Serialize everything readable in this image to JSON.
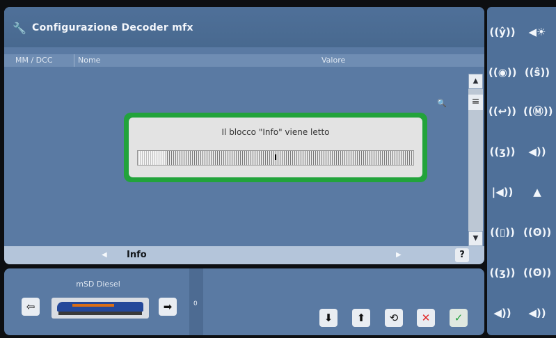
{
  "window": {
    "title": "Configurazione Decoder mfx",
    "title_icon": "wrench-icon"
  },
  "columns": {
    "mm_dcc": "MM / DCC",
    "nome": "Nome",
    "valore": "Valore"
  },
  "dialog": {
    "message": "Il blocco \"Info\" viene letto",
    "progress_mark": "I"
  },
  "nav": {
    "label": "Info",
    "left_arrow": "◀",
    "right_arrow": "▶",
    "help": "?"
  },
  "scroll": {
    "up": "▲",
    "down": "▼",
    "menu": "≡"
  },
  "loco": {
    "name": "mSD Diesel",
    "speed": "0",
    "prev": "⇦",
    "next": "➡"
  },
  "footer_buttons": {
    "cancel": "✕",
    "ok": "✓"
  },
  "right_icons": [
    "((ŷ))",
    "◀☀",
    "((◉))",
    "((ŝ))",
    "((↩))",
    "((Ⓜ))",
    "((ʒ))",
    "◀))",
    "|◀))",
    "▲",
    "((▯))",
    "((ʘ))",
    "((ʒ))",
    "((ʘ))",
    "◀))",
    "◀))"
  ],
  "colors": {
    "panel": "#5a7aa3",
    "dialog_border": "#22a33b",
    "cancel": "#e02323",
    "ok": "#1fa03a"
  }
}
